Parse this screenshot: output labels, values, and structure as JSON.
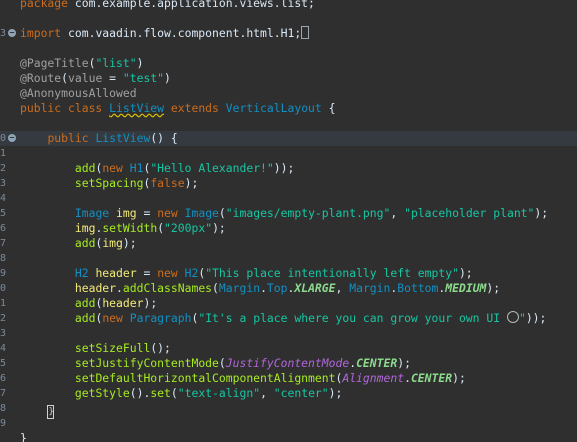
{
  "editor": {
    "lines": [
      {
        "num": "",
        "tokens": [
          [
            "kw",
            "package"
          ],
          [
            "plain",
            " com.example.application.views.list;"
          ]
        ]
      },
      {
        "num": "",
        "tokens": []
      },
      {
        "num": "3",
        "fold": true,
        "tokens": [
          [
            "kw",
            "import"
          ],
          [
            "plain",
            " com.vaadin.flow.component.html.H1;"
          ],
          [
            "box",
            ""
          ]
        ]
      },
      {
        "num": "",
        "tokens": []
      },
      {
        "num": "",
        "tokens": [
          [
            "ann",
            "@PageTitle"
          ],
          [
            "plain",
            "("
          ],
          [
            "str",
            "\"list\""
          ],
          [
            "plain",
            ")"
          ]
        ]
      },
      {
        "num": "",
        "tokens": [
          [
            "ann",
            "@Route"
          ],
          [
            "plain",
            "("
          ],
          [
            "ann",
            "value"
          ],
          [
            "plain",
            " = "
          ],
          [
            "str",
            "\"test\""
          ],
          [
            "plain",
            ")"
          ]
        ]
      },
      {
        "num": "",
        "tokens": [
          [
            "ann",
            "@AnonymousAllowed"
          ]
        ]
      },
      {
        "num": "",
        "tokens": [
          [
            "kw",
            "public class "
          ],
          [
            "cls_u",
            "ListView"
          ],
          [
            "kw",
            " extends "
          ],
          [
            "cls",
            "VerticalLayout"
          ],
          [
            "plain",
            " {"
          ]
        ]
      },
      {
        "num": "",
        "tokens": []
      },
      {
        "num": "0",
        "fold": true,
        "current": true,
        "tokens": [
          [
            "plain",
            "    "
          ],
          [
            "kw",
            "public "
          ],
          [
            "cls",
            "ListView"
          ],
          [
            "plain",
            "() {"
          ]
        ]
      },
      {
        "num": "1",
        "tokens": []
      },
      {
        "num": "2",
        "tokens": [
          [
            "plain",
            "        "
          ],
          [
            "mth",
            "add"
          ],
          [
            "plain",
            "("
          ],
          [
            "kw",
            "new "
          ],
          [
            "cls",
            "H1"
          ],
          [
            "plain",
            "("
          ],
          [
            "str",
            "\"Hello Alexander!\""
          ],
          [
            "plain",
            "));"
          ]
        ]
      },
      {
        "num": "3",
        "tokens": [
          [
            "plain",
            "        "
          ],
          [
            "mth",
            "setSpacing"
          ],
          [
            "plain",
            "("
          ],
          [
            "kw",
            "false"
          ],
          [
            "plain",
            ");"
          ]
        ]
      },
      {
        "num": "4",
        "tokens": []
      },
      {
        "num": "5",
        "tokens": [
          [
            "plain",
            "        "
          ],
          [
            "cls",
            "Image"
          ],
          [
            "plain",
            " "
          ],
          [
            "ident",
            "img"
          ],
          [
            "plain",
            " = "
          ],
          [
            "kw",
            "new "
          ],
          [
            "cls",
            "Image"
          ],
          [
            "plain",
            "("
          ],
          [
            "str",
            "\"images/empty-plant.png\""
          ],
          [
            "plain",
            ", "
          ],
          [
            "str",
            "\"placeholder plant\""
          ],
          [
            "plain",
            ");"
          ]
        ]
      },
      {
        "num": "6",
        "tokens": [
          [
            "plain",
            "        "
          ],
          [
            "ident",
            "img"
          ],
          [
            "plain",
            "."
          ],
          [
            "mth",
            "setWidth"
          ],
          [
            "plain",
            "("
          ],
          [
            "str",
            "\"200px\""
          ],
          [
            "plain",
            ");"
          ]
        ]
      },
      {
        "num": "7",
        "tokens": [
          [
            "plain",
            "        "
          ],
          [
            "mth",
            "add"
          ],
          [
            "plain",
            "("
          ],
          [
            "ident",
            "img"
          ],
          [
            "plain",
            ");"
          ]
        ]
      },
      {
        "num": "8",
        "tokens": []
      },
      {
        "num": "9",
        "tokens": [
          [
            "plain",
            "        "
          ],
          [
            "cls",
            "H2"
          ],
          [
            "plain",
            " "
          ],
          [
            "ident",
            "header"
          ],
          [
            "plain",
            " = "
          ],
          [
            "kw",
            "new "
          ],
          [
            "cls",
            "H2"
          ],
          [
            "plain",
            "("
          ],
          [
            "str",
            "\"This place intentionally left empty\""
          ],
          [
            "plain",
            ");"
          ]
        ]
      },
      {
        "num": "0",
        "tokens": [
          [
            "plain",
            "        "
          ],
          [
            "ident",
            "header"
          ],
          [
            "plain",
            "."
          ],
          [
            "mth",
            "addClassNames"
          ],
          [
            "plain",
            "("
          ],
          [
            "cls",
            "Margin"
          ],
          [
            "plain",
            "."
          ],
          [
            "cls",
            "Top"
          ],
          [
            "plain",
            "."
          ],
          [
            "static",
            "XLARGE"
          ],
          [
            "plain",
            ", "
          ],
          [
            "cls",
            "Margin"
          ],
          [
            "plain",
            "."
          ],
          [
            "cls",
            "Bottom"
          ],
          [
            "plain",
            "."
          ],
          [
            "static",
            "MEDIUM"
          ],
          [
            "plain",
            ");"
          ]
        ]
      },
      {
        "num": "1",
        "tokens": [
          [
            "plain",
            "        "
          ],
          [
            "mth",
            "add"
          ],
          [
            "plain",
            "("
          ],
          [
            "ident",
            "header"
          ],
          [
            "plain",
            ");"
          ]
        ]
      },
      {
        "num": "2",
        "tokens": [
          [
            "plain",
            "        "
          ],
          [
            "mth",
            "add"
          ],
          [
            "plain",
            "("
          ],
          [
            "kw",
            "new "
          ],
          [
            "cls",
            "Paragraph"
          ],
          [
            "plain",
            "("
          ],
          [
            "str",
            "\"It's a place where you can grow your own UI "
          ],
          [
            "emoji",
            ""
          ],
          [
            "str",
            "\""
          ],
          [
            "plain",
            "));"
          ]
        ]
      },
      {
        "num": "3",
        "tokens": []
      },
      {
        "num": "4",
        "tokens": [
          [
            "plain",
            "        "
          ],
          [
            "mth",
            "setSizeFull"
          ],
          [
            "plain",
            "();"
          ]
        ]
      },
      {
        "num": "5",
        "tokens": [
          [
            "plain",
            "        "
          ],
          [
            "mth",
            "setJustifyContentMode"
          ],
          [
            "plain",
            "("
          ],
          [
            "ital",
            "JustifyContentMode"
          ],
          [
            "plain",
            "."
          ],
          [
            "static",
            "CENTER"
          ],
          [
            "plain",
            ");"
          ]
        ]
      },
      {
        "num": "6",
        "tokens": [
          [
            "plain",
            "        "
          ],
          [
            "mth",
            "setDefaultHorizontalComponentAlignment"
          ],
          [
            "plain",
            "("
          ],
          [
            "ital",
            "Alignment"
          ],
          [
            "plain",
            "."
          ],
          [
            "static",
            "CENTER"
          ],
          [
            "plain",
            ");"
          ]
        ]
      },
      {
        "num": "7",
        "tokens": [
          [
            "plain",
            "        "
          ],
          [
            "mth",
            "getStyle"
          ],
          [
            "plain",
            "()."
          ],
          [
            "mth",
            "set"
          ],
          [
            "plain",
            "("
          ],
          [
            "str",
            "\"text-align\""
          ],
          [
            "plain",
            ", "
          ],
          [
            "str",
            "\"center\""
          ],
          [
            "plain",
            ");"
          ]
        ]
      },
      {
        "num": "8",
        "tokens": [
          [
            "plain",
            "    "
          ],
          [
            "caret",
            "}"
          ]
        ]
      },
      {
        "num": "9",
        "tokens": []
      },
      {
        "num": "",
        "tokens": [
          [
            "plain",
            "}"
          ]
        ]
      }
    ]
  },
  "colors": {
    "background": "#2f2f2f",
    "keyword": "#cc6c1d",
    "string": "#17c6a3",
    "class": "#1290c3",
    "method": "#a7ec21",
    "annotation": "#a0a0a0"
  }
}
